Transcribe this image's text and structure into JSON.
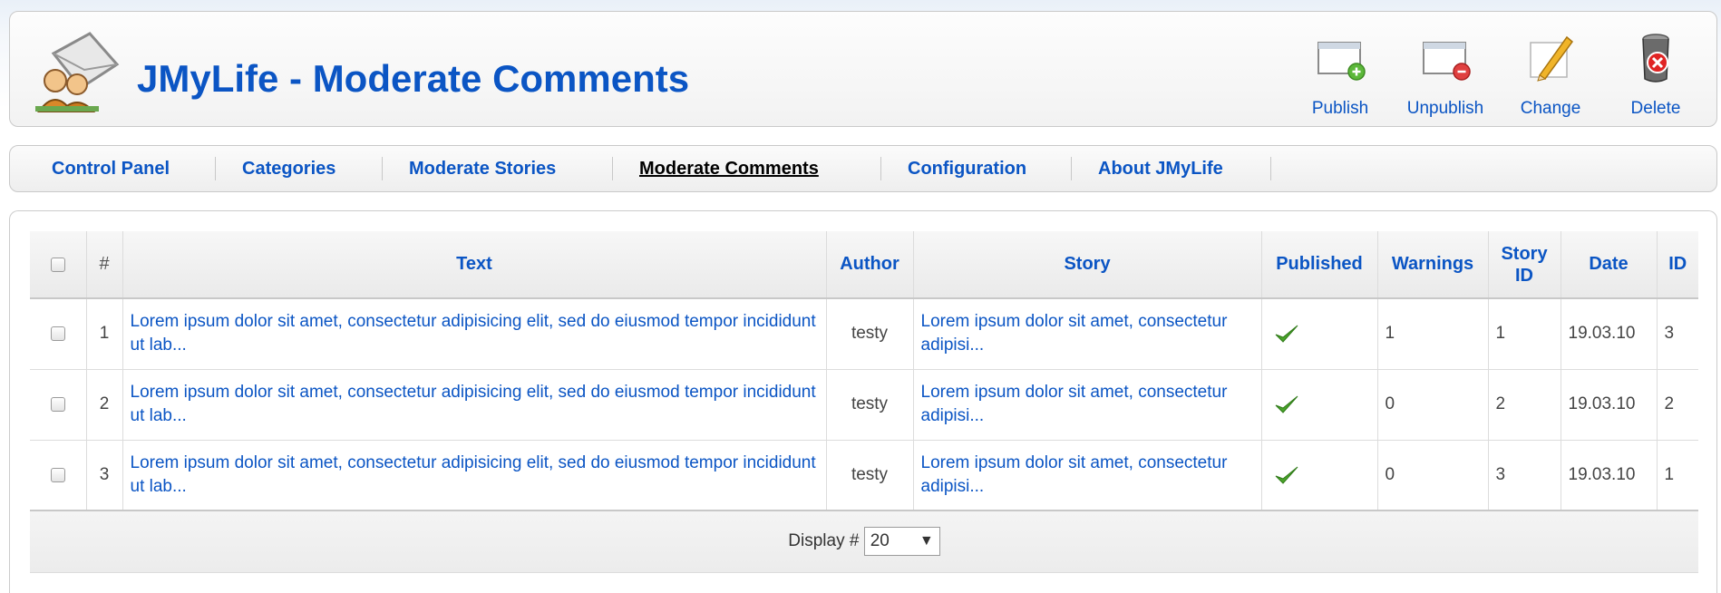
{
  "header": {
    "title": "JMyLife - Moderate Comments",
    "logo_icon": "users-comment-icon"
  },
  "toolbar": {
    "publish": "Publish",
    "unpublish": "Unpublish",
    "change": "Change",
    "delete": "Delete"
  },
  "submenu": {
    "items": [
      {
        "label": "Control Panel"
      },
      {
        "label": "Categories"
      },
      {
        "label": "Moderate Stories"
      },
      {
        "label": "Moderate Comments",
        "active": true
      },
      {
        "label": "Configuration"
      },
      {
        "label": "About JMyLife"
      }
    ]
  },
  "table": {
    "headers": {
      "num": "#",
      "text": "Text",
      "author": "Author",
      "story": "Story",
      "published": "Published",
      "warnings": "Warnings",
      "story_id": "Story ID",
      "date": "Date",
      "id": "ID"
    },
    "rows": [
      {
        "num": "1",
        "text": "Lorem ipsum dolor sit amet, consectetur adipisicing elit, sed do eiusmod tempor incididunt ut lab...",
        "author": "testy",
        "story": "Lorem ipsum dolor sit amet, consectetur adipisi...",
        "published": true,
        "warnings": "1",
        "story_id": "1",
        "date": "19.03.10",
        "id": "3"
      },
      {
        "num": "2",
        "text": "Lorem ipsum dolor sit amet, consectetur adipisicing elit, sed do eiusmod tempor incididunt ut lab...",
        "author": "testy",
        "story": "Lorem ipsum dolor sit amet, consectetur adipisi...",
        "published": true,
        "warnings": "0",
        "story_id": "2",
        "date": "19.03.10",
        "id": "2"
      },
      {
        "num": "3",
        "text": "Lorem ipsum dolor sit amet, consectetur adipisicing elit, sed do eiusmod tempor incididunt ut lab...",
        "author": "testy",
        "story": "Lorem ipsum dolor sit amet, consectetur adipisi...",
        "published": true,
        "warnings": "0",
        "story_id": "3",
        "date": "19.03.10",
        "id": "1"
      }
    ],
    "footer": {
      "display_label": "Display #",
      "display_value": "20"
    }
  },
  "colors": {
    "link": "#0b55c4",
    "check": "#4aa42a"
  }
}
